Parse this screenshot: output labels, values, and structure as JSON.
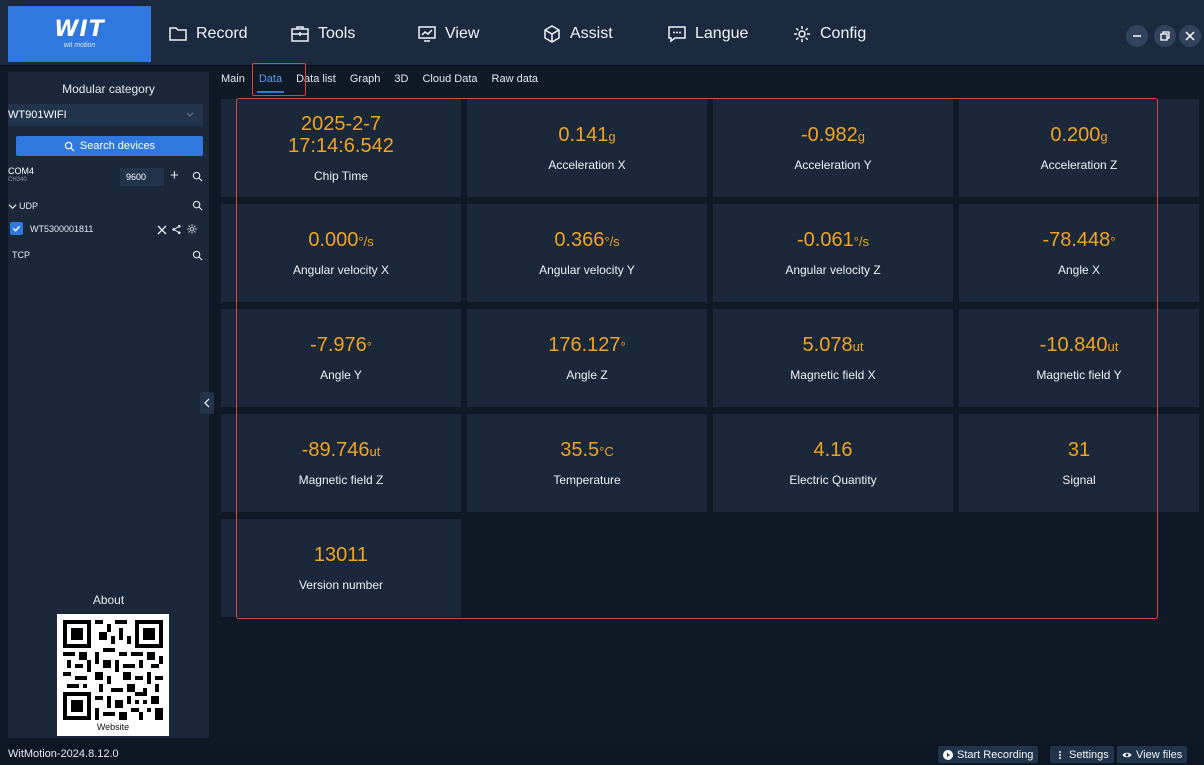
{
  "app": {
    "logo_text": "WIT",
    "logo_sub": "wit motion"
  },
  "menu": [
    {
      "label": "Record",
      "icon": "folder-icon"
    },
    {
      "label": "Tools",
      "icon": "toolbox-icon"
    },
    {
      "label": "View",
      "icon": "monitor-chart-icon"
    },
    {
      "label": "Assist",
      "icon": "cube-icon"
    },
    {
      "label": "Langue",
      "icon": "chat-icon"
    },
    {
      "label": "Config",
      "icon": "gear-icon"
    }
  ],
  "sidebar": {
    "title": "Modular category",
    "selected_device": "WT901WIFI",
    "search_label": "Search devices",
    "com_port": "COM4",
    "com_driver": "CH340",
    "baud_rate": "9600",
    "udp_label": "UDP",
    "device_id": "WT5300001811",
    "tcp_label": "TCP",
    "about_label": "About",
    "website_label": "Website"
  },
  "tabs": [
    {
      "label": "Main",
      "active": false
    },
    {
      "label": "Data",
      "active": true
    },
    {
      "label": "Data list",
      "active": false
    },
    {
      "label": "Graph",
      "active": false
    },
    {
      "label": "3D",
      "active": false
    },
    {
      "label": "Cloud Data",
      "active": false
    },
    {
      "label": "Raw data",
      "active": false
    }
  ],
  "cards": [
    {
      "value": "2025-2-7\n17:14:6.542",
      "unit": "",
      "label": "Chip Time"
    },
    {
      "value": "0.141",
      "unit": "g",
      "label": "Acceleration X"
    },
    {
      "value": "-0.982",
      "unit": "g",
      "label": "Acceleration Y"
    },
    {
      "value": "0.200",
      "unit": "g",
      "label": "Acceleration Z"
    },
    {
      "value": "0.000",
      "unit": "°/s",
      "label": "Angular velocity X"
    },
    {
      "value": "0.366",
      "unit": "°/s",
      "label": "Angular velocity Y"
    },
    {
      "value": "-0.061",
      "unit": "°/s",
      "label": "Angular velocity Z"
    },
    {
      "value": "-78.448",
      "unit": "°",
      "label": "Angle X"
    },
    {
      "value": "-7.976",
      "unit": "°",
      "label": "Angle Y"
    },
    {
      "value": "176.127",
      "unit": "°",
      "label": "Angle Z"
    },
    {
      "value": "5.078",
      "unit": "ut",
      "label": "Magnetic field X"
    },
    {
      "value": "-10.840",
      "unit": "ut",
      "label": "Magnetic field Y"
    },
    {
      "value": "-89.746",
      "unit": "ut",
      "label": "Magnetic field Z"
    },
    {
      "value": "35.5",
      "unit": "°C",
      "label": "Temperature"
    },
    {
      "value": "4.16",
      "unit": "",
      "label": "Electric Quantity"
    },
    {
      "value": "31",
      "unit": "",
      "label": "Signal"
    },
    {
      "value": "13011",
      "unit": "",
      "label": "Version number"
    }
  ],
  "status": {
    "version": "WitMotion-2024.8.12.0",
    "start_recording": "Start Recording",
    "settings": "Settings",
    "view_files": "View files"
  },
  "colors": {
    "accent": "#2f78df",
    "value": "#f2a320",
    "highlight": "#d94545",
    "panel": "#1a2839",
    "background": "#101a27"
  }
}
